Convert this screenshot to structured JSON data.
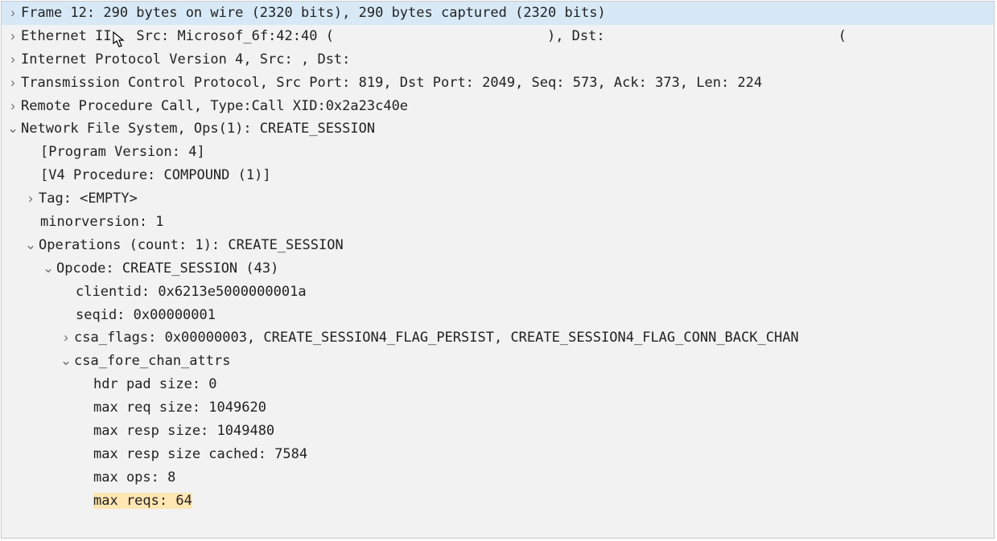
{
  "arrows": {
    "right": "›",
    "down": "⌄"
  },
  "rows": {
    "frame": "Frame 12: 290 bytes on wire (2320 bits), 290 bytes captured (2320 bits)",
    "eth_a": "Ethernet II,",
    "eth_b": "Src: Microsof_6f:42:40 (",
    "eth_c": "), Dst:",
    "eth_d": "(",
    "ip": "Internet Protocol Version 4, Src:          , Dst:",
    "tcp": "Transmission Control Protocol, Src Port: 819, Dst Port: 2049, Seq: 573, Ack: 373, Len: 224",
    "rpc": "Remote Procedure Call, Type:Call XID:0x2a23c40e",
    "nfs": "Network File System, Ops(1): CREATE_SESSION",
    "progver": "[Program Version: 4]",
    "v4proc": "[V4 Procedure: COMPOUND (1)]",
    "tag": "Tag: <EMPTY>",
    "minor": "minorversion: 1",
    "ops": "Operations (count: 1): CREATE_SESSION",
    "opcode": "Opcode: CREATE_SESSION (43)",
    "clientid": "clientid: 0x6213e5000000001a",
    "seqid": "seqid: 0x00000001",
    "csa": "csa_flags: 0x00000003, CREATE_SESSION4_FLAG_PERSIST, CREATE_SESSION4_FLAG_CONN_BACK_CHAN",
    "fore": "csa_fore_chan_attrs",
    "hdr": "hdr pad size: 0",
    "mreq": "max req size: 1049620",
    "mresp": "max resp size: 1049480",
    "mrespc": "max resp size cached: 7584",
    "mops": "max ops: 8",
    "mreqs": "max reqs: 64"
  }
}
